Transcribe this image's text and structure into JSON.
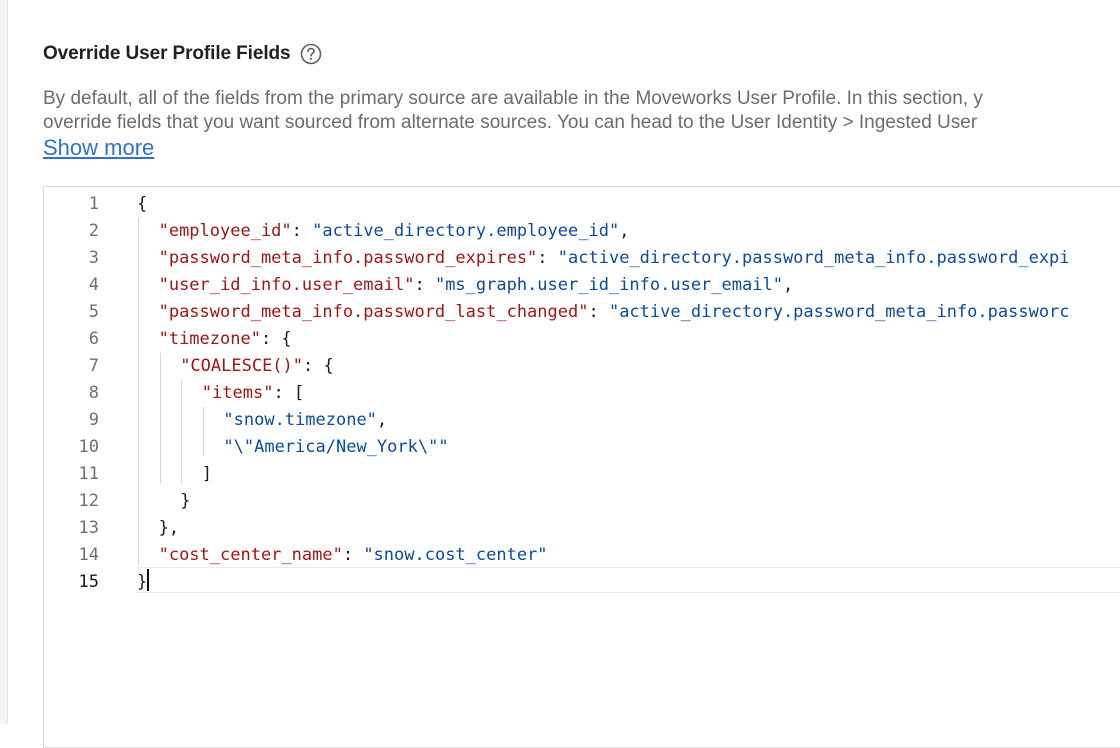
{
  "section": {
    "title": "Override User Profile Fields",
    "help_icon": "question-circle-icon",
    "description_line1": "By default, all of the fields from the primary source are available in the Moveworks User Profile. In this section, y",
    "description_line2": "override fields that you want sourced from alternate sources. You can head to the User Identity > Ingested User",
    "show_more_label": "Show more"
  },
  "editor": {
    "language": "json",
    "active_line": 15,
    "colors": {
      "key": "#a31515",
      "string": "#0b4b9c",
      "punctuation": "#1a1a1a",
      "line_number": "#6e6e75"
    },
    "lines": [
      {
        "n": "1",
        "tokens": [
          {
            "t": "punc",
            "v": "{"
          }
        ]
      },
      {
        "n": "2",
        "tokens": [
          {
            "t": "key",
            "v": "\"employee_id\""
          },
          {
            "t": "punc",
            "v": ": "
          },
          {
            "t": "str",
            "v": "\"active_directory.employee_id\""
          },
          {
            "t": "punc",
            "v": ","
          }
        ]
      },
      {
        "n": "3",
        "tokens": [
          {
            "t": "key",
            "v": "\"password_meta_info.password_expires\""
          },
          {
            "t": "punc",
            "v": ": "
          },
          {
            "t": "str",
            "v": "\"active_directory.password_meta_info.password_expi"
          }
        ]
      },
      {
        "n": "4",
        "tokens": [
          {
            "t": "key",
            "v": "\"user_id_info.user_email\""
          },
          {
            "t": "punc",
            "v": ": "
          },
          {
            "t": "str",
            "v": "\"ms_graph.user_id_info.user_email\""
          },
          {
            "t": "punc",
            "v": ","
          }
        ]
      },
      {
        "n": "5",
        "tokens": [
          {
            "t": "key",
            "v": "\"password_meta_info.password_last_changed\""
          },
          {
            "t": "punc",
            "v": ": "
          },
          {
            "t": "str",
            "v": "\"active_directory.password_meta_info.passworc"
          }
        ]
      },
      {
        "n": "6",
        "tokens": [
          {
            "t": "key",
            "v": "\"timezone\""
          },
          {
            "t": "punc",
            "v": ": {"
          }
        ]
      },
      {
        "n": "7",
        "tokens": [
          {
            "t": "key",
            "v": "\"COALESCE()\""
          },
          {
            "t": "punc",
            "v": ": {"
          }
        ]
      },
      {
        "n": "8",
        "tokens": [
          {
            "t": "key",
            "v": "\"items\""
          },
          {
            "t": "punc",
            "v": ": ["
          }
        ]
      },
      {
        "n": "9",
        "tokens": [
          {
            "t": "str",
            "v": "\"snow.timezone\""
          },
          {
            "t": "punc",
            "v": ","
          }
        ]
      },
      {
        "n": "10",
        "tokens": [
          {
            "t": "str",
            "v": "\"\\\"America/New_York\\\"\""
          }
        ]
      },
      {
        "n": "11",
        "tokens": [
          {
            "t": "punc",
            "v": "]"
          }
        ]
      },
      {
        "n": "12",
        "tokens": [
          {
            "t": "punc",
            "v": "}"
          }
        ]
      },
      {
        "n": "13",
        "tokens": [
          {
            "t": "punc",
            "v": "},"
          }
        ]
      },
      {
        "n": "14",
        "tokens": [
          {
            "t": "key",
            "v": "\"cost_center_name\""
          },
          {
            "t": "punc",
            "v": ": "
          },
          {
            "t": "str",
            "v": "\"snow.cost_center\""
          }
        ]
      },
      {
        "n": "15",
        "tokens": [
          {
            "t": "punc",
            "v": "}"
          }
        ]
      }
    ]
  }
}
